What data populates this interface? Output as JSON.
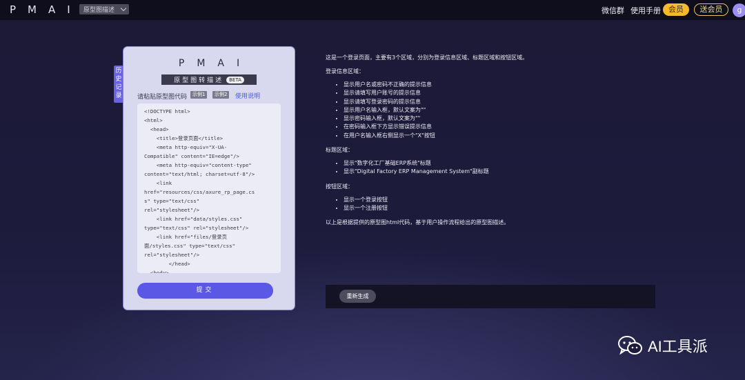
{
  "header": {
    "logo": "PMAI",
    "mode_select": "原型图描述",
    "wechat_group": "微信群",
    "manual": "使用手册",
    "member": "会员",
    "gift_member": "送会员",
    "avatar": "g"
  },
  "sidebar": {
    "history_tab": "历史记录"
  },
  "card": {
    "logo": "PMAI",
    "subtitle": "原型图转描述",
    "beta": "BETA",
    "paste_label": "请粘贴原型图代码",
    "example1": "示例1",
    "example2": "示例2",
    "help_link": "使用说明",
    "code": "<!DOCTYPE html>\n<html>\n  <head>\n    <title>登录页面</title>\n    <meta http-equiv=\"X-UA-\nCompatible\" content=\"IE=edge\"/>\n    <meta http-equiv=\"content-type\"\ncontent=\"text/html; charset=utf-8\"/>\n    <link\nhref=\"resources/css/axure_rp_page.cs\ns\" type=\"text/css\"\nrel=\"stylesheet\"/>\n    <link href=\"data/styles.css\"\ntype=\"text/css\" rel=\"stylesheet\"/>\n    <link href=\"files/登录页\n面/styles.css\" type=\"text/css\"\nrel=\"stylesheet\"/>\n        </head>\n  <body>",
    "submit": "提交"
  },
  "description": {
    "intro": "这是一个登录页面，主要有3个区域，分别为登录信息区域、标题区域和按钮区域。",
    "section1_title": "登录信息区域：",
    "section1_items": [
      "显示用户名或密码不正确的提示信息",
      "显示请填写用户账号的提示信息",
      "显示请填写登录密码的提示信息",
      "显示用户名输入框，默认文案为\"\"",
      "显示密码输入框，默认文案为\"\"",
      "在密码输入框下方显示错误提示信息",
      "在用户名输入框右侧显示一个\"X\"按钮"
    ],
    "section2_title": "标题区域：",
    "section2_items": [
      "显示\"数字化工厂基础ERP系统\"标题",
      "显示\"Digital Factory ERP Management System\"副标题"
    ],
    "section3_title": "按钮区域：",
    "section3_items": [
      "显示一个登录按钮",
      "显示一个注册按钮"
    ],
    "outro": "以上是根据提供的原型图html代码，基于用户操作流程给出的原型图描述。"
  },
  "regenerate": "重新生成",
  "watermark": "AI工具派",
  "colors": {
    "accent": "#5b58e6",
    "member": "#f6b830",
    "background": "#1d1b3b"
  }
}
